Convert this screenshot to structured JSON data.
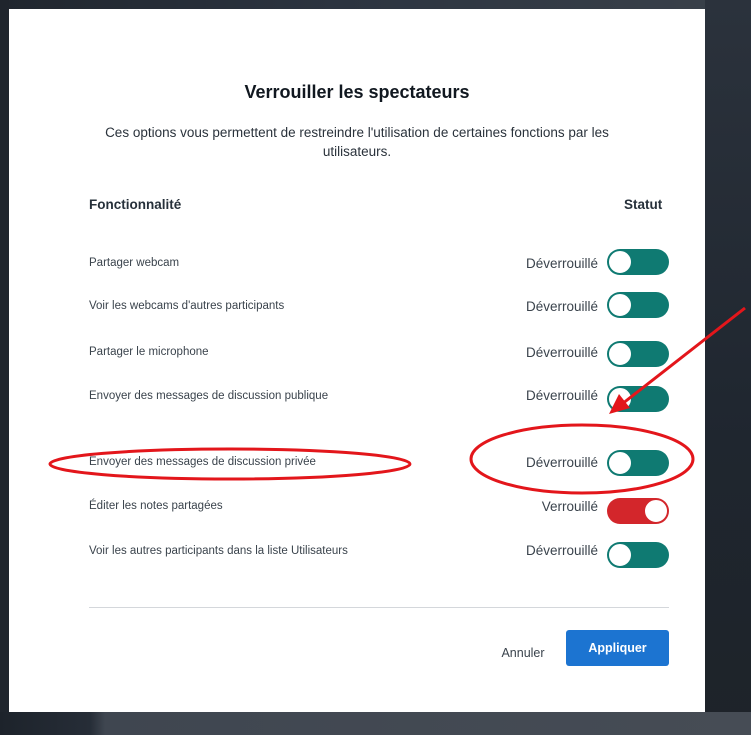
{
  "modal": {
    "title": "Verrouiller les spectateurs",
    "description": "Ces options vous permettent de restreindre l'utilisation de certaines fonctions par les utilisateurs.",
    "header_feature": "Fonctionnalité",
    "header_status": "Statut",
    "rows": [
      {
        "label": "Partager webcam",
        "status": "Déverrouillé",
        "locked": false
      },
      {
        "label": "Voir les webcams d'autres participants",
        "status": "Déverrouillé",
        "locked": false
      },
      {
        "label": "Partager le microphone",
        "status": "Déverrouillé",
        "locked": false
      },
      {
        "label": "Envoyer des messages de discussion publique",
        "status": "Déverrouillé",
        "locked": false
      },
      {
        "label": "Envoyer des messages de discussion privée",
        "status": "Déverrouillé",
        "locked": false
      },
      {
        "label": "Éditer les notes partagées",
        "status": "Verrouillé",
        "locked": true
      },
      {
        "label": "Voir les autres participants dans la liste Utilisateurs",
        "status": "Déverrouillé",
        "locked": false
      }
    ],
    "cancel_label": "Annuler",
    "apply_label": "Appliquer"
  },
  "colors": {
    "unlocked_toggle": "#0f7a72",
    "locked_toggle": "#d3262b",
    "apply_button": "#1c74d1",
    "annotation": "#e3161b"
  }
}
